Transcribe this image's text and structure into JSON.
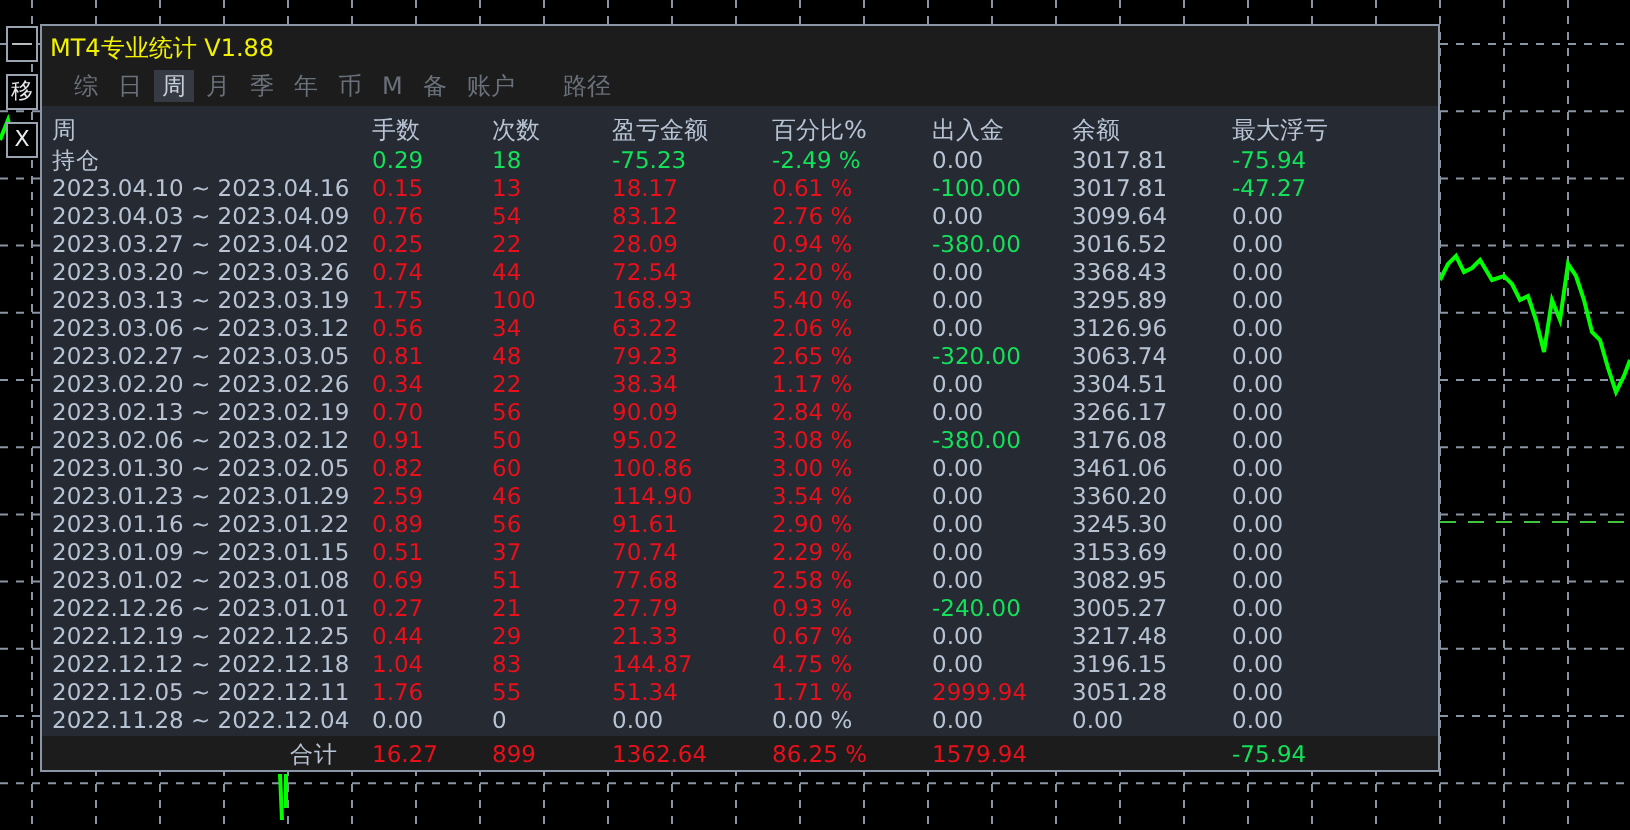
{
  "side_buttons": [
    "—",
    "移",
    "X"
  ],
  "window": {
    "title": "MT4专业统计 V1.88"
  },
  "tabs": [
    {
      "label": "综",
      "selected": false
    },
    {
      "label": "日",
      "selected": false
    },
    {
      "label": "周",
      "selected": true
    },
    {
      "label": "月",
      "selected": false
    },
    {
      "label": "季",
      "selected": false
    },
    {
      "label": "年",
      "selected": false
    },
    {
      "label": "币",
      "selected": false
    },
    {
      "label": "M",
      "selected": false
    },
    {
      "label": "备",
      "selected": false
    },
    {
      "label": "账户",
      "selected": false
    },
    {
      "label": "路径",
      "selected": false
    }
  ],
  "table": {
    "columns": [
      "周",
      "手数",
      "次数",
      "盈亏金额",
      "百分比%",
      "出入金",
      "余额",
      "最大浮亏"
    ],
    "rows": [
      {
        "cells": [
          {
            "text": "持仓"
          },
          {
            "text": "0.29",
            "color": "#14e05a"
          },
          {
            "text": "18",
            "color": "#14e05a"
          },
          {
            "text": "-75.23",
            "color": "#14e05a"
          },
          {
            "text": "-2.49 %",
            "color": "#14e05a"
          },
          {
            "text": "0.00"
          },
          {
            "text": "3017.81"
          },
          {
            "text": "-75.94",
            "color": "#14e05a"
          }
        ]
      },
      {
        "cells": [
          {
            "text": "2023.04.10 ~ 2023.04.16"
          },
          {
            "text": "0.15",
            "color": "#e8101a"
          },
          {
            "text": "13",
            "color": "#e8101a"
          },
          {
            "text": "18.17",
            "color": "#e8101a"
          },
          {
            "text": "0.61 %",
            "color": "#e8101a"
          },
          {
            "text": "-100.00",
            "color": "#14e05a"
          },
          {
            "text": "3017.81"
          },
          {
            "text": "-47.27",
            "color": "#14e05a"
          }
        ]
      },
      {
        "cells": [
          {
            "text": "2023.04.03 ~ 2023.04.09"
          },
          {
            "text": "0.76",
            "color": "#e8101a"
          },
          {
            "text": "54",
            "color": "#e8101a"
          },
          {
            "text": "83.12",
            "color": "#e8101a"
          },
          {
            "text": "2.76 %",
            "color": "#e8101a"
          },
          {
            "text": "0.00"
          },
          {
            "text": "3099.64"
          },
          {
            "text": "0.00"
          }
        ]
      },
      {
        "cells": [
          {
            "text": "2023.03.27 ~ 2023.04.02"
          },
          {
            "text": "0.25",
            "color": "#e8101a"
          },
          {
            "text": "22",
            "color": "#e8101a"
          },
          {
            "text": "28.09",
            "color": "#e8101a"
          },
          {
            "text": "0.94 %",
            "color": "#e8101a"
          },
          {
            "text": "-380.00",
            "color": "#14e05a"
          },
          {
            "text": "3016.52"
          },
          {
            "text": "0.00"
          }
        ]
      },
      {
        "cells": [
          {
            "text": "2023.03.20 ~ 2023.03.26"
          },
          {
            "text": "0.74",
            "color": "#e8101a"
          },
          {
            "text": "44",
            "color": "#e8101a"
          },
          {
            "text": "72.54",
            "color": "#e8101a"
          },
          {
            "text": "2.20 %",
            "color": "#e8101a"
          },
          {
            "text": "0.00"
          },
          {
            "text": "3368.43"
          },
          {
            "text": "0.00"
          }
        ]
      },
      {
        "cells": [
          {
            "text": "2023.03.13 ~ 2023.03.19"
          },
          {
            "text": "1.75",
            "color": "#e8101a"
          },
          {
            "text": "100",
            "color": "#e8101a"
          },
          {
            "text": "168.93",
            "color": "#e8101a"
          },
          {
            "text": "5.40 %",
            "color": "#e8101a"
          },
          {
            "text": "0.00"
          },
          {
            "text": "3295.89"
          },
          {
            "text": "0.00"
          }
        ]
      },
      {
        "cells": [
          {
            "text": "2023.03.06 ~ 2023.03.12"
          },
          {
            "text": "0.56",
            "color": "#e8101a"
          },
          {
            "text": "34",
            "color": "#e8101a"
          },
          {
            "text": "63.22",
            "color": "#e8101a"
          },
          {
            "text": "2.06 %",
            "color": "#e8101a"
          },
          {
            "text": "0.00"
          },
          {
            "text": "3126.96"
          },
          {
            "text": "0.00"
          }
        ]
      },
      {
        "cells": [
          {
            "text": "2023.02.27 ~ 2023.03.05"
          },
          {
            "text": "0.81",
            "color": "#e8101a"
          },
          {
            "text": "48",
            "color": "#e8101a"
          },
          {
            "text": "79.23",
            "color": "#e8101a"
          },
          {
            "text": "2.65 %",
            "color": "#e8101a"
          },
          {
            "text": "-320.00",
            "color": "#14e05a"
          },
          {
            "text": "3063.74"
          },
          {
            "text": "0.00"
          }
        ]
      },
      {
        "cells": [
          {
            "text": "2023.02.20 ~ 2023.02.26"
          },
          {
            "text": "0.34",
            "color": "#e8101a"
          },
          {
            "text": "22",
            "color": "#e8101a"
          },
          {
            "text": "38.34",
            "color": "#e8101a"
          },
          {
            "text": "1.17 %",
            "color": "#e8101a"
          },
          {
            "text": "0.00"
          },
          {
            "text": "3304.51"
          },
          {
            "text": "0.00"
          }
        ]
      },
      {
        "cells": [
          {
            "text": "2023.02.13 ~ 2023.02.19"
          },
          {
            "text": "0.70",
            "color": "#e8101a"
          },
          {
            "text": "56",
            "color": "#e8101a"
          },
          {
            "text": "90.09",
            "color": "#e8101a"
          },
          {
            "text": "2.84 %",
            "color": "#e8101a"
          },
          {
            "text": "0.00"
          },
          {
            "text": "3266.17"
          },
          {
            "text": "0.00"
          }
        ]
      },
      {
        "cells": [
          {
            "text": "2023.02.06 ~ 2023.02.12"
          },
          {
            "text": "0.91",
            "color": "#e8101a"
          },
          {
            "text": "50",
            "color": "#e8101a"
          },
          {
            "text": "95.02",
            "color": "#e8101a"
          },
          {
            "text": "3.08 %",
            "color": "#e8101a"
          },
          {
            "text": "-380.00",
            "color": "#14e05a"
          },
          {
            "text": "3176.08"
          },
          {
            "text": "0.00"
          }
        ]
      },
      {
        "cells": [
          {
            "text": "2023.01.30 ~ 2023.02.05"
          },
          {
            "text": "0.82",
            "color": "#e8101a"
          },
          {
            "text": "60",
            "color": "#e8101a"
          },
          {
            "text": "100.86",
            "color": "#e8101a"
          },
          {
            "text": "3.00 %",
            "color": "#e8101a"
          },
          {
            "text": "0.00"
          },
          {
            "text": "3461.06"
          },
          {
            "text": "0.00"
          }
        ]
      },
      {
        "cells": [
          {
            "text": "2023.01.23 ~ 2023.01.29"
          },
          {
            "text": "2.59",
            "color": "#e8101a"
          },
          {
            "text": "46",
            "color": "#e8101a"
          },
          {
            "text": "114.90",
            "color": "#e8101a"
          },
          {
            "text": "3.54 %",
            "color": "#e8101a"
          },
          {
            "text": "0.00"
          },
          {
            "text": "3360.20"
          },
          {
            "text": "0.00"
          }
        ]
      },
      {
        "cells": [
          {
            "text": "2023.01.16 ~ 2023.01.22"
          },
          {
            "text": "0.89",
            "color": "#e8101a"
          },
          {
            "text": "56",
            "color": "#e8101a"
          },
          {
            "text": "91.61",
            "color": "#e8101a"
          },
          {
            "text": "2.90 %",
            "color": "#e8101a"
          },
          {
            "text": "0.00"
          },
          {
            "text": "3245.30"
          },
          {
            "text": "0.00"
          }
        ]
      },
      {
        "cells": [
          {
            "text": "2023.01.09 ~ 2023.01.15"
          },
          {
            "text": "0.51",
            "color": "#e8101a"
          },
          {
            "text": "37",
            "color": "#e8101a"
          },
          {
            "text": "70.74",
            "color": "#e8101a"
          },
          {
            "text": "2.29 %",
            "color": "#e8101a"
          },
          {
            "text": "0.00"
          },
          {
            "text": "3153.69"
          },
          {
            "text": "0.00"
          }
        ]
      },
      {
        "cells": [
          {
            "text": "2023.01.02 ~ 2023.01.08"
          },
          {
            "text": "0.69",
            "color": "#e8101a"
          },
          {
            "text": "51",
            "color": "#e8101a"
          },
          {
            "text": "77.68",
            "color": "#e8101a"
          },
          {
            "text": "2.58 %",
            "color": "#e8101a"
          },
          {
            "text": "0.00"
          },
          {
            "text": "3082.95"
          },
          {
            "text": "0.00"
          }
        ]
      },
      {
        "cells": [
          {
            "text": "2022.12.26 ~ 2023.01.01"
          },
          {
            "text": "0.27",
            "color": "#e8101a"
          },
          {
            "text": "21",
            "color": "#e8101a"
          },
          {
            "text": "27.79",
            "color": "#e8101a"
          },
          {
            "text": "0.93 %",
            "color": "#e8101a"
          },
          {
            "text": "-240.00",
            "color": "#14e05a"
          },
          {
            "text": "3005.27"
          },
          {
            "text": "0.00"
          }
        ]
      },
      {
        "cells": [
          {
            "text": "2022.12.19 ~ 2022.12.25"
          },
          {
            "text": "0.44",
            "color": "#e8101a"
          },
          {
            "text": "29",
            "color": "#e8101a"
          },
          {
            "text": "21.33",
            "color": "#e8101a"
          },
          {
            "text": "0.67 %",
            "color": "#e8101a"
          },
          {
            "text": "0.00"
          },
          {
            "text": "3217.48"
          },
          {
            "text": "0.00"
          }
        ]
      },
      {
        "cells": [
          {
            "text": "2022.12.12 ~ 2022.12.18"
          },
          {
            "text": "1.04",
            "color": "#e8101a"
          },
          {
            "text": "83",
            "color": "#e8101a"
          },
          {
            "text": "144.87",
            "color": "#e8101a"
          },
          {
            "text": "4.75 %",
            "color": "#e8101a"
          },
          {
            "text": "0.00"
          },
          {
            "text": "3196.15"
          },
          {
            "text": "0.00"
          }
        ]
      },
      {
        "cells": [
          {
            "text": "2022.12.05 ~ 2022.12.11"
          },
          {
            "text": "1.76",
            "color": "#e8101a"
          },
          {
            "text": "55",
            "color": "#e8101a"
          },
          {
            "text": "51.34",
            "color": "#e8101a"
          },
          {
            "text": "1.71 %",
            "color": "#e8101a"
          },
          {
            "text": "2999.94",
            "color": "#e8101a"
          },
          {
            "text": "3051.28"
          },
          {
            "text": "0.00"
          }
        ]
      },
      {
        "cells": [
          {
            "text": "2022.11.28 ~ 2022.12.04"
          },
          {
            "text": "0.00"
          },
          {
            "text": "0"
          },
          {
            "text": "0.00"
          },
          {
            "text": "0.00 %"
          },
          {
            "text": "0.00"
          },
          {
            "text": "0.00"
          },
          {
            "text": "0.00"
          }
        ]
      }
    ],
    "footer": {
      "label": {
        "text": "合计"
      },
      "lots": {
        "text": "16.27",
        "color": "#e8101a"
      },
      "trades": {
        "text": "899",
        "color": "#e8101a"
      },
      "profit": {
        "text": "1362.64",
        "color": "#e8101a"
      },
      "percent": {
        "text": "86.25 %",
        "color": "#e8101a"
      },
      "deposit": {
        "text": "1579.94",
        "color": "#e8101a"
      },
      "max_drawdown": {
        "text": "-75.94",
        "color": "#14e05a"
      }
    }
  }
}
